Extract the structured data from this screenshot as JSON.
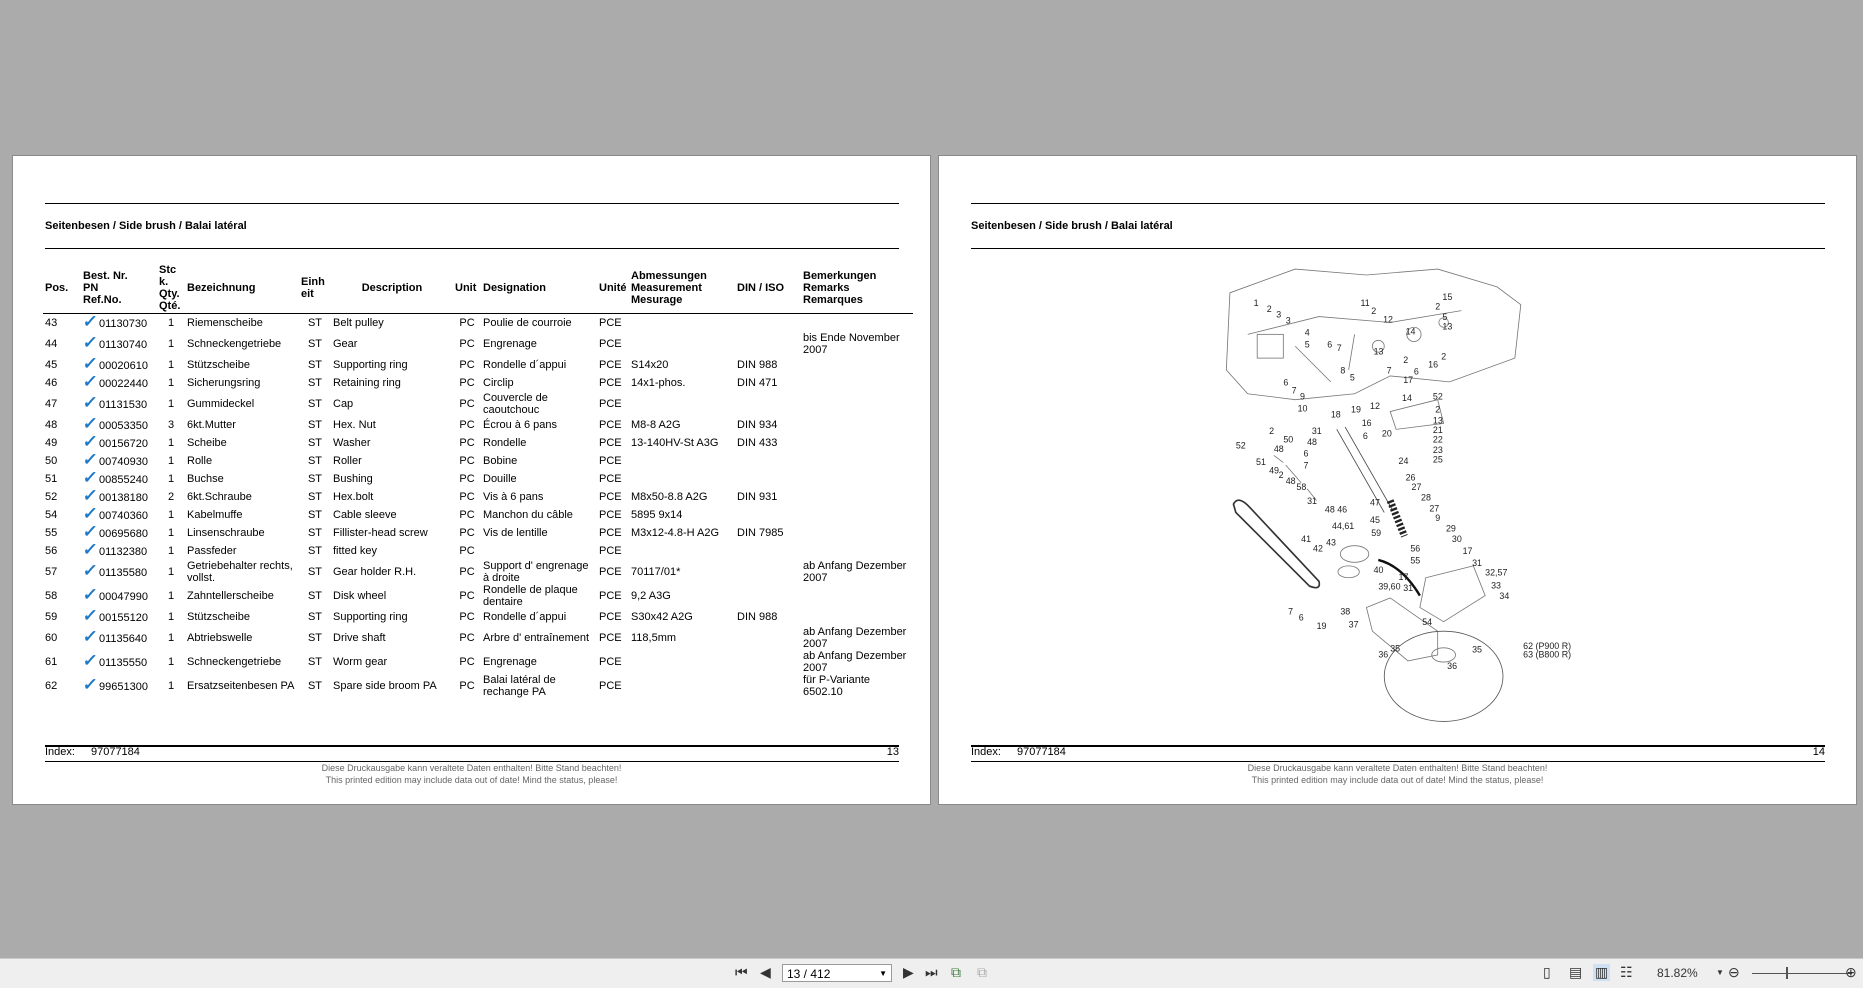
{
  "section_title": "Seitenbesen / Side brush / Balai latéral",
  "table": {
    "headers": {
      "pos": "Pos.",
      "pn": [
        "Best. Nr.",
        "PN",
        "Ref.No."
      ],
      "qty": [
        "Stc",
        "k.",
        "Qty.",
        "Qté."
      ],
      "bez": "Bezeichnung",
      "einh": [
        "Einh",
        "eit"
      ],
      "desc": "Description",
      "unit": "Unit",
      "designation": "Designation",
      "unite": "Unité",
      "measure": [
        "Abmessungen",
        "Measurement",
        "Mesurage"
      ],
      "din": "DIN / ISO",
      "remarks": [
        "Bemerkungen",
        "Remarks",
        "Remarques"
      ]
    },
    "rows": [
      {
        "pos": "43",
        "pn": "01130730",
        "qty": "1",
        "bez": "Riemenscheibe",
        "einh": "ST",
        "desc": "Belt pulley",
        "unit": "PC",
        "designation": "Poulie de courroie",
        "unite": "PCE",
        "measure": "",
        "din": "",
        "remarks": ""
      },
      {
        "pos": "44",
        "pn": "01130740",
        "qty": "1",
        "bez": "Schneckengetriebe",
        "einh": "ST",
        "desc": "Gear",
        "unit": "PC",
        "designation": "Engrenage",
        "unite": "PCE",
        "measure": "",
        "din": "",
        "remarks": "bis Ende November 2007"
      },
      {
        "pos": "45",
        "pn": "00020610",
        "qty": "1",
        "bez": "Stützscheibe",
        "einh": "ST",
        "desc": "Supporting ring",
        "unit": "PC",
        "designation": "Rondelle d´appui",
        "unite": "PCE",
        "measure": "S14x20",
        "din": "DIN 988",
        "remarks": ""
      },
      {
        "pos": "46",
        "pn": "00022440",
        "qty": "1",
        "bez": "Sicherungsring",
        "einh": "ST",
        "desc": "Retaining ring",
        "unit": "PC",
        "designation": "Circlip",
        "unite": "PCE",
        "measure": "14x1-phos.",
        "din": "DIN 471",
        "remarks": ""
      },
      {
        "pos": "47",
        "pn": "01131530",
        "qty": "1",
        "bez": "Gummideckel",
        "einh": "ST",
        "desc": "Cap",
        "unit": "PC",
        "designation": "Couvercle de caoutchouc",
        "unite": "PCE",
        "measure": "",
        "din": "",
        "remarks": ""
      },
      {
        "pos": "48",
        "pn": "00053350",
        "qty": "3",
        "bez": "6kt.Mutter",
        "einh": "ST",
        "desc": "Hex. Nut",
        "unit": "PC",
        "designation": "Écrou à 6 pans",
        "unite": "PCE",
        "measure": "M8-8 A2G",
        "din": "DIN 934",
        "remarks": ""
      },
      {
        "pos": "49",
        "pn": "00156720",
        "qty": "1",
        "bez": "Scheibe",
        "einh": "ST",
        "desc": "Washer",
        "unit": "PC",
        "designation": "Rondelle",
        "unite": "PCE",
        "measure": "13-140HV-St A3G",
        "din": "DIN 433",
        "remarks": ""
      },
      {
        "pos": "50",
        "pn": "00740930",
        "qty": "1",
        "bez": "Rolle",
        "einh": "ST",
        "desc": "Roller",
        "unit": "PC",
        "designation": "Bobine",
        "unite": "PCE",
        "measure": "",
        "din": "",
        "remarks": ""
      },
      {
        "pos": "51",
        "pn": "00855240",
        "qty": "1",
        "bez": "Buchse",
        "einh": "ST",
        "desc": "Bushing",
        "unit": "PC",
        "designation": "Douille",
        "unite": "PCE",
        "measure": "",
        "din": "",
        "remarks": ""
      },
      {
        "pos": "52",
        "pn": "00138180",
        "qty": "2",
        "bez": "6kt.Schraube",
        "einh": "ST",
        "desc": "Hex.bolt",
        "unit": "PC",
        "designation": "Vis à 6 pans",
        "unite": "PCE",
        "measure": "M8x50-8.8 A2G",
        "din": "DIN 931",
        "remarks": ""
      },
      {
        "pos": "54",
        "pn": "00740360",
        "qty": "1",
        "bez": "Kabelmuffe",
        "einh": "ST",
        "desc": "Cable sleeve",
        "unit": "PC",
        "designation": "Manchon du câble",
        "unite": "PCE",
        "measure": "5895 9x14",
        "din": "",
        "remarks": ""
      },
      {
        "pos": "55",
        "pn": "00695680",
        "qty": "1",
        "bez": "Linsenschraube",
        "einh": "ST",
        "desc": "Fillister-head screw",
        "unit": "PC",
        "designation": "Vis de lentille",
        "unite": "PCE",
        "measure": "M3x12-4.8-H A2G",
        "din": "DIN 7985",
        "remarks": ""
      },
      {
        "pos": "56",
        "pn": "01132380",
        "qty": "1",
        "bez": "Passfeder",
        "einh": "ST",
        "desc": "fitted key",
        "unit": "PC",
        "designation": "",
        "unite": "PCE",
        "measure": "",
        "din": "",
        "remarks": ""
      },
      {
        "pos": "57",
        "pn": "01135580",
        "qty": "1",
        "bez": "Getriebehalter rechts, vollst.",
        "einh": "ST",
        "desc": "Gear holder R.H.",
        "unit": "PC",
        "designation": "Support d' engrenage à droite",
        "unite": "PCE",
        "measure": "70117/01*",
        "din": "",
        "remarks": "ab Anfang Dezember 2007"
      },
      {
        "pos": "58",
        "pn": "00047990",
        "qty": "1",
        "bez": "Zahntellerscheibe",
        "einh": "ST",
        "desc": "Disk wheel",
        "unit": "PC",
        "designation": "Rondelle de plaque dentaire",
        "unite": "PCE",
        "measure": "9,2 A3G",
        "din": "",
        "remarks": ""
      },
      {
        "pos": "59",
        "pn": "00155120",
        "qty": "1",
        "bez": "Stützscheibe",
        "einh": "ST",
        "desc": "Supporting ring",
        "unit": "PC",
        "designation": "Rondelle d´appui",
        "unite": "PCE",
        "measure": "S30x42 A2G",
        "din": "DIN 988",
        "remarks": ""
      },
      {
        "pos": "60",
        "pn": "01135640",
        "qty": "1",
        "bez": "Abtriebswelle",
        "einh": "ST",
        "desc": "Drive shaft",
        "unit": "PC",
        "designation": "Arbre d' entraînement",
        "unite": "PCE",
        "measure": "118,5mm",
        "din": "",
        "remarks": "ab Anfang Dezember 2007"
      },
      {
        "pos": "61",
        "pn": "01135550",
        "qty": "1",
        "bez": "Schneckengetriebe",
        "einh": "ST",
        "desc": "Worm gear",
        "unit": "PC",
        "designation": "Engrenage",
        "unite": "PCE",
        "measure": "",
        "din": "",
        "remarks": "ab Anfang Dezember 2007"
      },
      {
        "pos": "62",
        "pn": "99651300",
        "qty": "1",
        "bez": "Ersatzseitenbesen PA",
        "einh": "ST",
        "desc": "Spare side broom PA",
        "unit": "PC",
        "designation": "Balai latéral de rechange PA",
        "unite": "PCE",
        "measure": "",
        "din": "",
        "remarks": "für P-Variante 6502.10"
      }
    ]
  },
  "footer": {
    "index_label": "Index:",
    "index_value": "97077184",
    "left_page_number": "13",
    "right_page_number": "14",
    "disclaimer_de": "Diese Druckausgabe kann veraltete Daten enthalten! Bitte Stand beachten!",
    "disclaimer_en": "This printed edition may include data out of date! Mind the status, please!"
  },
  "diagram": {
    "callouts": [
      "1",
      "2",
      "3",
      "3",
      "11",
      "2",
      "12",
      "15",
      "2",
      "5",
      "13",
      "14",
      "4",
      "5",
      "6",
      "7",
      "13",
      "2",
      "16",
      "2",
      "7",
      "6",
      "17",
      "8",
      "5",
      "6",
      "7",
      "9",
      "10",
      "52",
      "14",
      "2",
      "13",
      "12",
      "19",
      "18",
      "52",
      "2",
      "50",
      "48",
      "6",
      "7",
      "51",
      "49",
      "2",
      "48",
      "58",
      "31",
      "48",
      "16",
      "6",
      "20",
      "21",
      "22",
      "23",
      "25",
      "24",
      "26",
      "27",
      "31",
      "48 46",
      "47",
      "28",
      "27",
      "9",
      "44,61",
      "45",
      "59",
      "29",
      "30",
      "41",
      "42",
      "43",
      "56",
      "17",
      "55",
      "31",
      "32,57",
      "40",
      "17",
      "33",
      "39,60",
      "31",
      "34",
      "7",
      "6",
      "38",
      "19",
      "37",
      "54",
      "36",
      "35",
      "35",
      "36",
      "62 (P900 R)",
      "63 (B800 R)"
    ]
  },
  "toolbar": {
    "page_field": "13 / 412",
    "zoom_level": "81.82%",
    "zoom_slider_fraction": 0.35
  },
  "colors": {
    "check": "#1e78c8",
    "background": "#ababab"
  }
}
